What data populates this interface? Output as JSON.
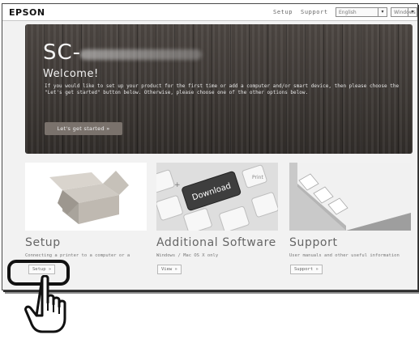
{
  "topbar": {
    "logo": "EPSON",
    "nav": [
      "Setup",
      "Support"
    ],
    "language_select": "English",
    "os_select": "Windows"
  },
  "hero": {
    "title": "SC-",
    "welcome": "Welcome!",
    "body": "If you would like to set up your product for the first time or add a computer and/or smart device, then please choose the \"Let's get started\" button below. Otherwise, please choose one of the other options below.",
    "button": "Let's get started »"
  },
  "cards": [
    {
      "title": "Setup",
      "desc": "Connecting a printer to a computer or a",
      "button": "Setup »",
      "image": "open-cardboard-box"
    },
    {
      "title": "Additional Software",
      "desc": "Windows / Mac OS X only",
      "button": "View »",
      "image": "keyboard-download-key",
      "key_text": "Download"
    },
    {
      "title": "Support",
      "desc": "User manuals and other useful information",
      "button": "Support »",
      "image": "manual-book-with-tabs"
    }
  ],
  "annotation": {
    "hand_icon": "pointing-hand-icon",
    "highlight_target": "setup-button"
  }
}
